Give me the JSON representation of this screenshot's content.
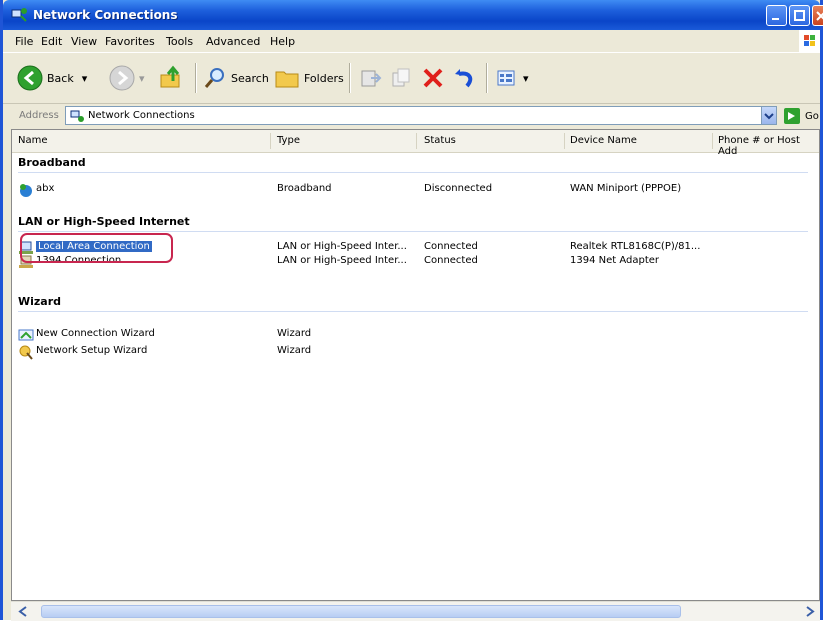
{
  "window": {
    "title": "Network Connections"
  },
  "menu": {
    "items": [
      "File",
      "Edit",
      "View",
      "Favorites",
      "Tools",
      "Advanced",
      "Help"
    ]
  },
  "toolbar": {
    "back_label": "Back",
    "search_label": "Search",
    "folders_label": "Folders",
    "views_icon": "views-icon"
  },
  "address": {
    "label": "Address",
    "value": "Network Connections",
    "go_label": "Go"
  },
  "columns": {
    "name": "Name",
    "type": "Type",
    "status": "Status",
    "device": "Device Name",
    "phone": "Phone # or Host Add"
  },
  "groups": [
    {
      "title": "Broadband",
      "rows": [
        {
          "name": "abx",
          "type": "Broadband",
          "status": "Disconnected",
          "device": "WAN Miniport (PPPOE)"
        }
      ]
    },
    {
      "title": "LAN or High-Speed Internet",
      "rows": [
        {
          "name": "Local Area Connection",
          "type": "LAN or High-Speed Inter...",
          "status": "Connected",
          "device": "Realtek RTL8168C(P)/81..."
        },
        {
          "name": "1394 Connection",
          "type": "LAN or High-Speed Inter...",
          "status": "Connected",
          "device": "1394 Net Adapter"
        }
      ]
    },
    {
      "title": "Wizard",
      "rows": [
        {
          "name": "New Connection Wizard",
          "type": "Wizard",
          "status": "",
          "device": ""
        },
        {
          "name": "Network Setup Wizard",
          "type": "Wizard",
          "status": "",
          "device": ""
        }
      ]
    }
  ],
  "colors": {
    "titlebar": "#0a45c8",
    "selection": "#316ac5",
    "highlight_ring": "#c8264f"
  }
}
